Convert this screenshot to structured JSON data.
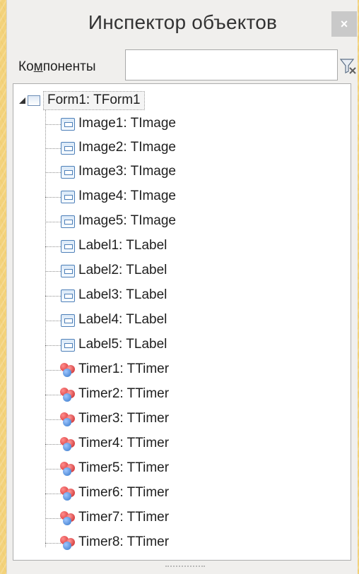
{
  "window": {
    "title": "Инспектор объектов",
    "close_label": "×"
  },
  "filter": {
    "label_prefix": "Ко",
    "label_underlined": "м",
    "label_suffix": "поненты",
    "value": "",
    "placeholder": ""
  },
  "tree": {
    "root_label": "Form1: TForm1",
    "children": [
      {
        "label": "Image1: TImage",
        "icon": "component-icon"
      },
      {
        "label": "Image2: TImage",
        "icon": "component-icon"
      },
      {
        "label": "Image3: TImage",
        "icon": "component-icon"
      },
      {
        "label": "Image4: TImage",
        "icon": "component-icon"
      },
      {
        "label": "Image5: TImage",
        "icon": "component-icon"
      },
      {
        "label": "Label1: TLabel",
        "icon": "component-icon"
      },
      {
        "label": "Label2: TLabel",
        "icon": "component-icon"
      },
      {
        "label": "Label3: TLabel",
        "icon": "component-icon"
      },
      {
        "label": "Label4: TLabel",
        "icon": "component-icon"
      },
      {
        "label": "Label5: TLabel",
        "icon": "component-icon"
      },
      {
        "label": "Timer1: TTimer",
        "icon": "timer-icon"
      },
      {
        "label": "Timer2: TTimer",
        "icon": "timer-icon"
      },
      {
        "label": "Timer3: TTimer",
        "icon": "timer-icon"
      },
      {
        "label": "Timer4: TTimer",
        "icon": "timer-icon"
      },
      {
        "label": "Timer5: TTimer",
        "icon": "timer-icon"
      },
      {
        "label": "Timer6: TTimer",
        "icon": "timer-icon"
      },
      {
        "label": "Timer7: TTimer",
        "icon": "timer-icon"
      },
      {
        "label": "Timer8: TTimer",
        "icon": "timer-icon"
      }
    ]
  },
  "colors": {
    "background": "#f3d27a",
    "panel": "#f0efed",
    "close_button": "#c9c9c9",
    "component_icon": "#4d7fb8",
    "timer_icon_red": "#d22b2b",
    "timer_icon_blue": "#3577c9"
  }
}
